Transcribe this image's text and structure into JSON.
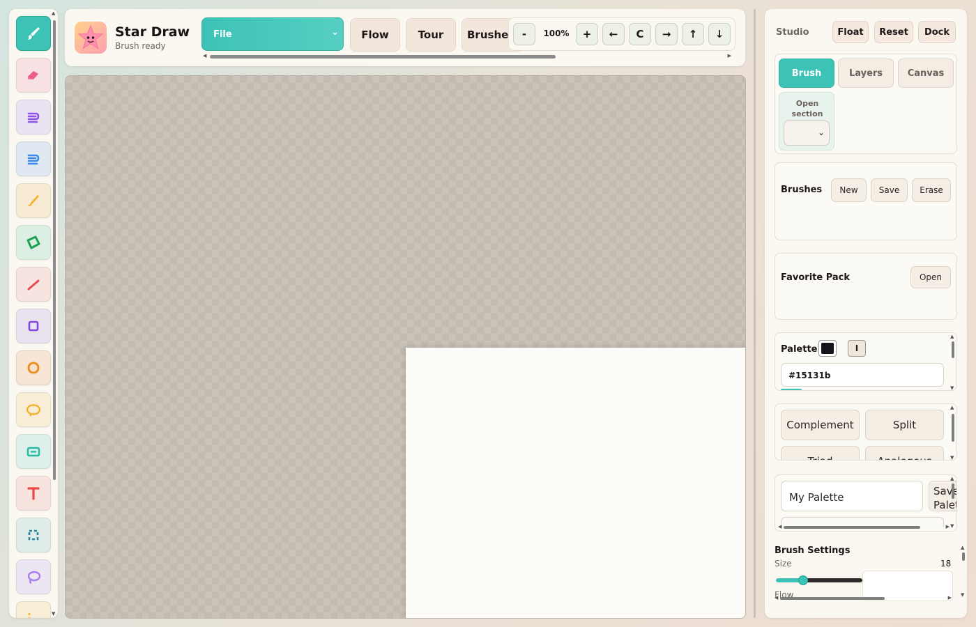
{
  "app": {
    "title": "Star Draw",
    "status": "Brush ready"
  },
  "tools": [
    {
      "name": "brush-tool",
      "icon": "brush-icon",
      "color": "#ffffff",
      "bg": "#3dc2b6",
      "active": true
    },
    {
      "name": "eraser-tool",
      "icon": "eraser-icon",
      "color": "#ee5d86",
      "bg": "#f7e1e2"
    },
    {
      "name": "pen-tool",
      "icon": "pen-icon",
      "color": "#8e54e9",
      "bg": "#ebe3f2"
    },
    {
      "name": "ink-tool",
      "icon": "ink-icon",
      "color": "#3d8cec",
      "bg": "#e0e9f1"
    },
    {
      "name": "pencil-tool",
      "icon": "pencil-icon",
      "color": "#f5b427",
      "bg": "#f8ebd3"
    },
    {
      "name": "fill-tool",
      "icon": "fill-icon",
      "color": "#1aa156",
      "bg": "#ddefe3"
    },
    {
      "name": "line-tool",
      "icon": "line-icon",
      "color": "#e64b4b",
      "bg": "#f7e3e0"
    },
    {
      "name": "rectangle-tool",
      "icon": "square-icon",
      "color": "#7a49e0",
      "bg": "#e9e3f0"
    },
    {
      "name": "circle-tool",
      "icon": "circle-icon",
      "color": "#f08a16",
      "bg": "#f7e5d4"
    },
    {
      "name": "ellipse-tool",
      "icon": "ellipse-icon",
      "color": "#f5b42a",
      "bg": "#f8edd6"
    },
    {
      "name": "text-box-tool",
      "icon": "textbox-icon",
      "color": "#23bca9",
      "bg": "#dff0ea"
    },
    {
      "name": "text-tool",
      "icon": "text-icon",
      "color": "#ef4444",
      "bg": "#f8e4df"
    },
    {
      "name": "select-tool",
      "icon": "select-icon",
      "color": "#1e8aa0",
      "bg": "#e0ece9"
    },
    {
      "name": "lasso-tool",
      "icon": "lasso-icon",
      "color": "#a67cf0",
      "bg": "#ece5f2"
    },
    {
      "name": "crop-tool",
      "icon": "crop-icon",
      "color": "#f5b42a",
      "bg": "#f8edd6"
    }
  ],
  "toolbar": {
    "file_label": "File",
    "flow_label": "Flow",
    "tour_label": "Tour",
    "brushes_label": "Brushes",
    "zoom_out": "-",
    "zoom_value": "100%",
    "zoom_in": "+",
    "pan_left": "←",
    "center": "C",
    "pan_right": "→",
    "pan_up": "↑",
    "pan_down": "↓"
  },
  "studio": {
    "title": "Studio",
    "float": "Float",
    "reset": "Reset",
    "dock": "Dock",
    "tabs": [
      "Brush",
      "Layers",
      "Canvas"
    ],
    "open_section_label": "Open section",
    "brushes": {
      "label": "Brushes",
      "new": "New",
      "save": "Save",
      "erase": "Erase"
    },
    "favorite": {
      "label": "Favorite Pack",
      "open": "Open"
    },
    "palette": {
      "label": "Palette",
      "swatch_color": "#15131b",
      "toggle": "I",
      "hex": "#15131b"
    },
    "harmony": [
      "Complement",
      "Split",
      "Triad",
      "Analogous"
    ],
    "my_palette": {
      "value": "My Palette",
      "save": "Save Palette"
    },
    "brush_settings": {
      "title": "Brush Settings",
      "size_label": "Size",
      "size_value": "18",
      "flow_label": "Flow"
    }
  },
  "colors": {
    "accent": "#3dc2b6",
    "button": "#f3e6dc",
    "panel": "#fbf8f1"
  }
}
